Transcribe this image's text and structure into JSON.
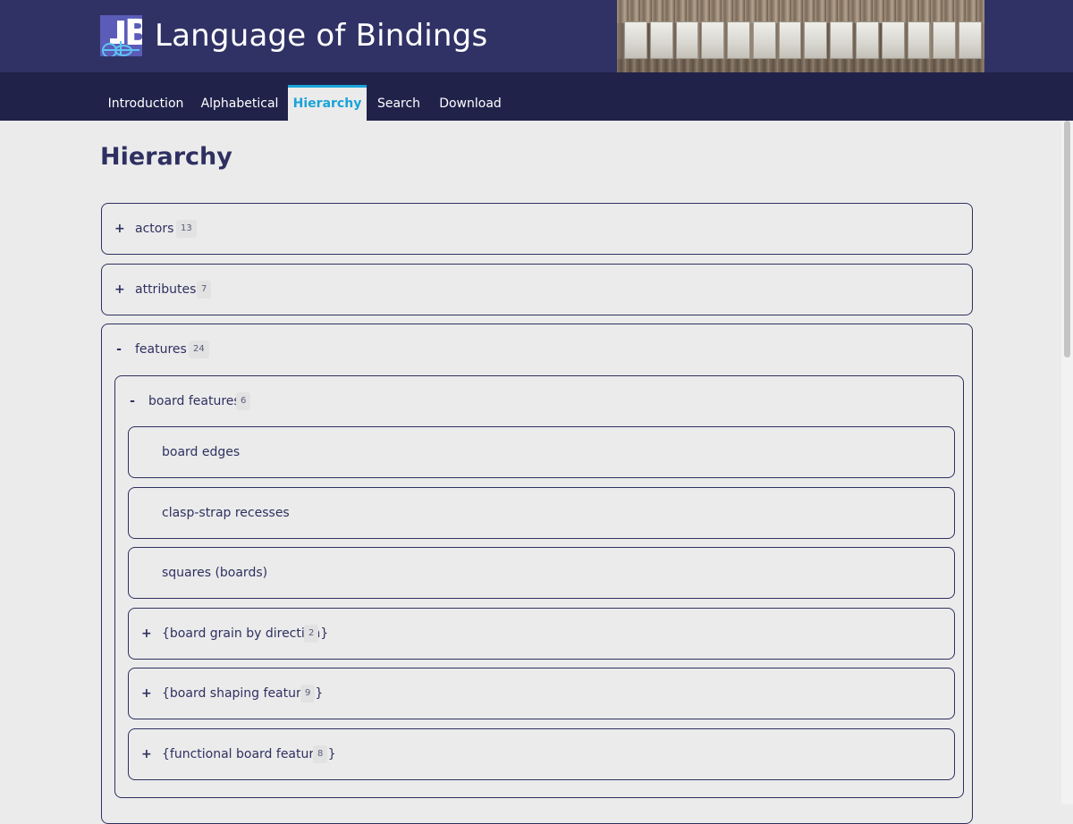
{
  "site": {
    "title": "Language of Bindings"
  },
  "nav": {
    "tabs": [
      {
        "label": "Introduction"
      },
      {
        "label": "Alphabetical"
      },
      {
        "label": "Hierarchy",
        "active": true
      },
      {
        "label": "Search"
      },
      {
        "label": "Download"
      }
    ]
  },
  "colors": {
    "header": "#303266",
    "nav": "#20224a",
    "accent": "#1aa3d8",
    "text": "#2f3061",
    "background": "#ebebeb"
  },
  "page": {
    "title": "Hierarchy"
  },
  "tree": {
    "actors": {
      "toggle": "+",
      "label": "actors",
      "count": "13"
    },
    "attributes": {
      "toggle": "+",
      "label": "attributes",
      "count": "7"
    },
    "features": {
      "toggle": "-",
      "label": "features",
      "count": "24",
      "board_features": {
        "toggle": "-",
        "label": "board features",
        "count": "6",
        "children": [
          {
            "label": "board edges"
          },
          {
            "label": "clasp-strap recesses"
          },
          {
            "label": "squares (boards)"
          },
          {
            "toggle": "+",
            "label": "{board grain by direction}",
            "count": "2"
          },
          {
            "toggle": "+",
            "label": "{board shaping features}",
            "count": "9"
          },
          {
            "toggle": "+",
            "label": "{functional board features}",
            "count": "8"
          }
        ]
      }
    }
  }
}
